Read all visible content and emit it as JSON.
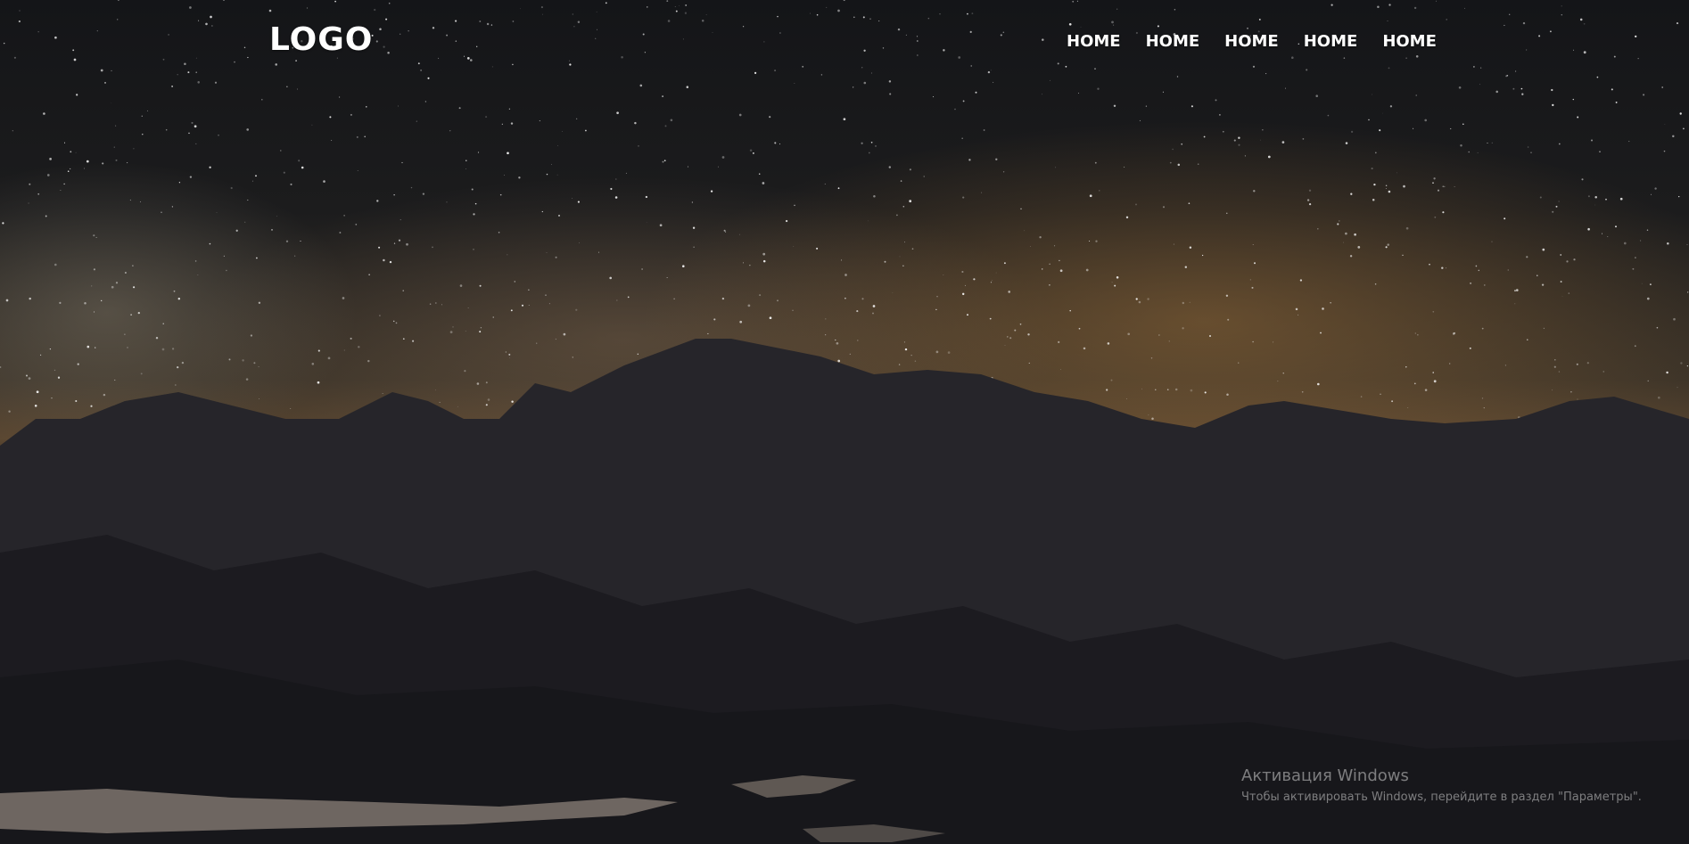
{
  "header": {
    "logo": "LOGO",
    "nav": [
      {
        "label": "HOME"
      },
      {
        "label": "HOME"
      },
      {
        "label": "HOME"
      },
      {
        "label": "HOME"
      },
      {
        "label": "HOME"
      }
    ]
  },
  "hero": {
    "background_image": "night sky with milky way over mountains"
  },
  "watermark": {
    "title": "Активация Windows",
    "subtitle": "Чтобы активировать Windows, перейдите в раздел \"Параметры\"."
  },
  "colors": {
    "text": "#ffffff",
    "sky_dark": "#141518",
    "glow": "#aa783c",
    "mountain": "#1e1e22",
    "water": "#b7a89a"
  }
}
